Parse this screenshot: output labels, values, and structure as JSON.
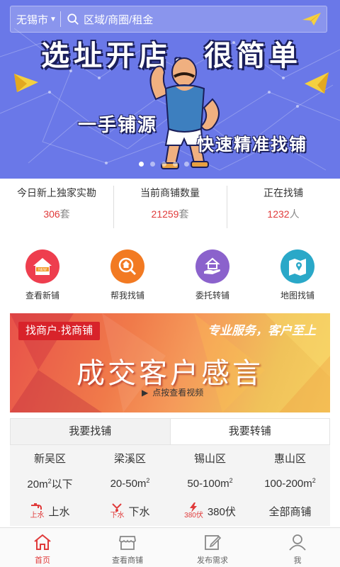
{
  "header": {
    "city": "无锡市",
    "search_placeholder": "区域/商圈/租金"
  },
  "banner": {
    "title": "选址开店，很简单",
    "sub1": "一手铺源",
    "sub2": "快速精准找铺",
    "slide_count": 5,
    "active_slide": 1
  },
  "stats": [
    {
      "label": "今日新上独家实勘",
      "value": "306",
      "unit": "套"
    },
    {
      "label": "当前商铺数量",
      "value": "21259",
      "unit": "套"
    },
    {
      "label": "正在找铺",
      "value": "1232",
      "unit": "人"
    }
  ],
  "quick_menu": [
    {
      "label": "查看新铺",
      "icon": "new-house-icon",
      "color": "#ee3e4e"
    },
    {
      "label": "帮我找铺",
      "icon": "search-house-icon",
      "color": "#f27a22"
    },
    {
      "label": "委托转铺",
      "icon": "hand-house-icon",
      "color": "#8b62cc"
    },
    {
      "label": "地图找铺",
      "icon": "map-icon",
      "color": "#2aa8c8"
    }
  ],
  "promo": {
    "tag": "找商户·找商铺",
    "slogan": "专业服务，客户至上",
    "title": "成交客户感言",
    "play_label": "点按查看视频"
  },
  "tabs": [
    {
      "label": "我要找铺",
      "active": true
    },
    {
      "label": "我要转铺",
      "active": false
    }
  ],
  "districts": [
    "新吴区",
    "梁溪区",
    "锡山区",
    "惠山区"
  ],
  "areas": [
    {
      "text": "20m",
      "sup": "2",
      "suffix": "以下"
    },
    {
      "text": "20-50m",
      "sup": "2",
      "suffix": ""
    },
    {
      "text": "50-100m",
      "sup": "2",
      "suffix": ""
    },
    {
      "text": "100-200m",
      "sup": "2",
      "suffix": ""
    }
  ],
  "features": [
    {
      "badge": "上水",
      "label": "上水"
    },
    {
      "badge": "下水",
      "label": "下水"
    },
    {
      "badge": "380伏",
      "label": "380伏"
    },
    {
      "badge": "",
      "label": "全部商铺"
    }
  ],
  "bottom_nav": [
    {
      "label": "首页",
      "active": true
    },
    {
      "label": "查看商铺",
      "active": false
    },
    {
      "label": "发布需求",
      "active": false
    },
    {
      "label": "我",
      "active": false
    }
  ],
  "colors": {
    "accent": "#e03a3a",
    "banner_bg": "#6a78e8"
  }
}
